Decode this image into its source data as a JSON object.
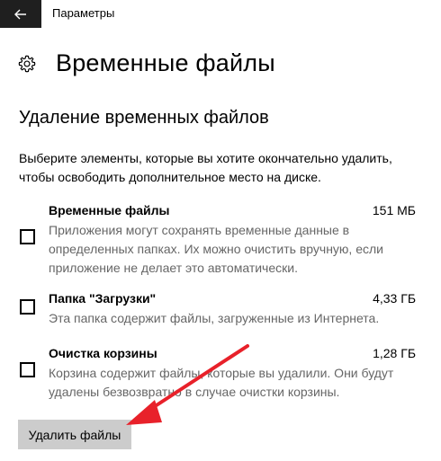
{
  "window": {
    "title": "Параметры"
  },
  "page": {
    "title": "Временные файлы"
  },
  "section": {
    "title": "Удаление временных файлов",
    "description": "Выберите элементы, которые вы хотите окончательно удалить, чтобы освободить дополнительное место на диске."
  },
  "items": [
    {
      "name": "Временные файлы",
      "size": "151 МБ",
      "description": "Приложения могут сохранять временные данные в определенных папках. Их можно очистить вручную, если приложение не делает это автоматически.",
      "checked": false
    },
    {
      "name": "Папка \"Загрузки\"",
      "size": "4,33 ГБ",
      "description": "Эта папка содержит файлы, загруженные из Интернета.",
      "checked": false
    },
    {
      "name": "Очистка корзины",
      "size": "1,28 ГБ",
      "description": "Корзина содержит файлы, которые вы удалили. Они будут удалены безвозвратно в случае очистки корзины.",
      "checked": false
    }
  ],
  "actions": {
    "delete_label": "Удалить файлы"
  },
  "icons": {
    "back": "back-arrow-icon",
    "settings": "gear-icon",
    "annotation": "red-arrow-annotation"
  },
  "colors": {
    "titlebar_button": "#1f1f1f",
    "secondary_text": "#666666",
    "button_bg": "#cccccc",
    "annotation": "#e8212a"
  }
}
